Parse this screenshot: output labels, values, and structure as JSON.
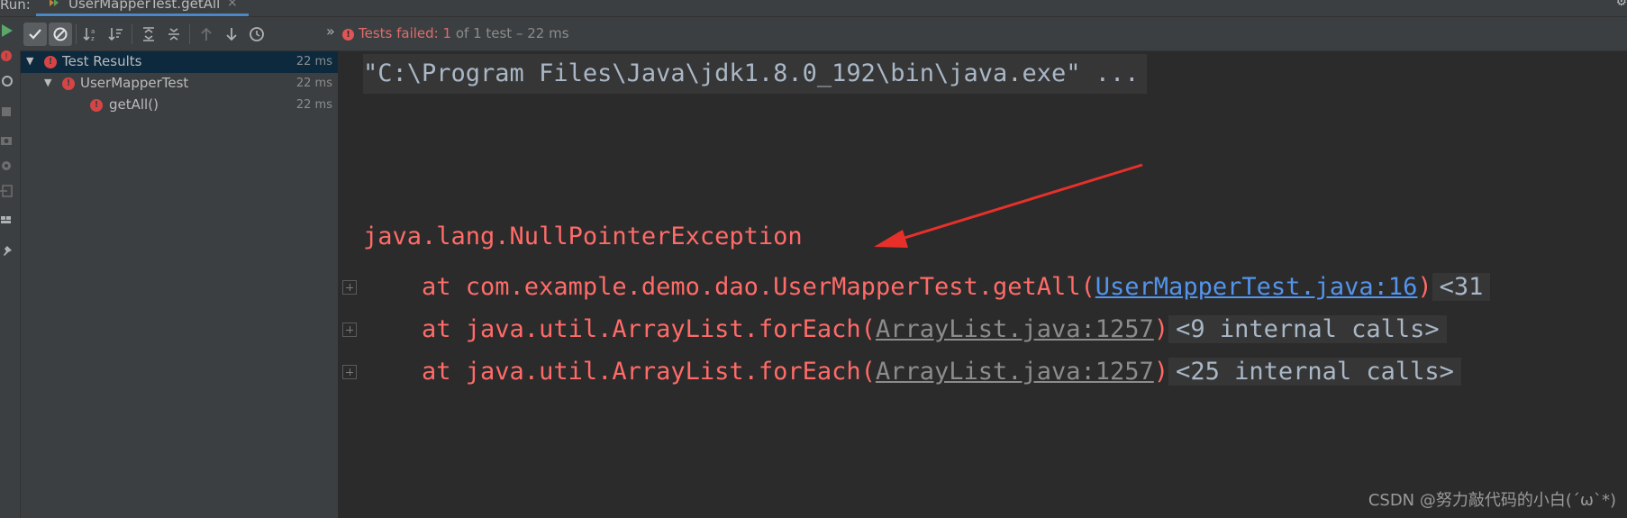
{
  "run_panel": {
    "label": "Run:",
    "tab_title": "UserMapperTest.getAll",
    "tab_close": "×"
  },
  "toolbar": {
    "buttons": [
      {
        "icon": "show-passed-check-icon",
        "active": true
      },
      {
        "icon": "show-ignored-icon",
        "active": true
      },
      {
        "icon": "sort-alphabetically-icon"
      },
      {
        "icon": "sort-by-duration-icon"
      },
      {
        "icon": "expand-all-icon"
      },
      {
        "icon": "collapse-all-icon"
      },
      {
        "icon": "previous-failed-icon"
      },
      {
        "icon": "next-failed-icon"
      },
      {
        "icon": "test-history-icon"
      },
      {
        "icon": "more-chevron-icon"
      }
    ],
    "more": "»"
  },
  "status": {
    "prefix": "Tests failed:",
    "failed_count": "1",
    "rest": "of 1 test – 22 ms"
  },
  "tree": {
    "items": [
      {
        "label": "Test Results",
        "time": "22 ms",
        "level": 0
      },
      {
        "label": "UserMapperTest",
        "time": "22 ms",
        "level": 1
      },
      {
        "label": "getAll()",
        "time": "22 ms",
        "level": 2
      }
    ]
  },
  "console": {
    "command": "\"C:\\Program Files\\Java\\jdk1.8.0_192\\bin\\java.exe\" ...",
    "exception": "java.lang.NullPointerException",
    "traces": [
      {
        "prefix": "    at com.example.demo.dao.UserMapperTest.getAll(",
        "link": "UserMapperTest.java:16",
        "suffix": ")",
        "internal": "<31"
      },
      {
        "prefix": "    at java.util.ArrayList.forEach(",
        "link": "ArrayList.java:1257",
        "suffix": ")",
        "internal": "<9 internal calls>"
      },
      {
        "prefix": "    at java.util.ArrayList.forEach(",
        "link": "ArrayList.java:1257",
        "suffix": ")",
        "internal": "<25 internal calls>"
      }
    ]
  },
  "colors": {
    "error_red": "#ff6b68",
    "link_blue": "#5394ec",
    "annotation_arrow": "#e8302a"
  },
  "watermark": "CSDN @努力敲代码的小白(´ω`*)"
}
